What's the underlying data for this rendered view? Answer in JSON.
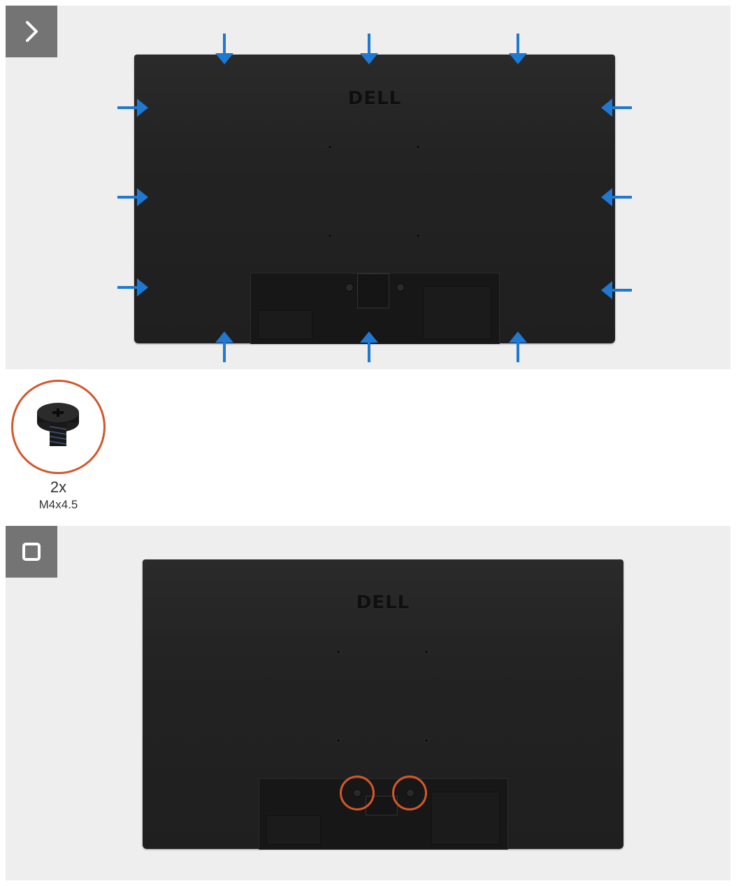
{
  "step1": {
    "badge_icon": "chevron-right-icon",
    "logo_text": "DELL",
    "arrow_color": "#1f78d1"
  },
  "screw": {
    "count": "2x",
    "spec": "M4x4.5",
    "ring_color": "#d2582b"
  },
  "step2": {
    "badge_icon": "square-stop-icon",
    "logo_text": "DELL"
  }
}
